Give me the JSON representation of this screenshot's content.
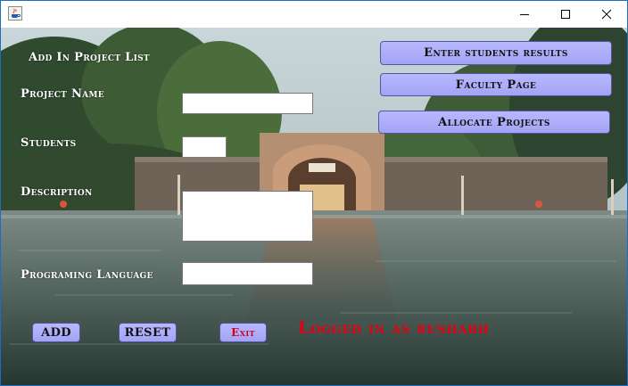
{
  "window": {
    "title": "",
    "controls": {
      "minimize": "minimize",
      "maximize": "maximize",
      "close": "close"
    }
  },
  "form": {
    "heading": "Add In Project List",
    "project_name_label": "Project Name",
    "project_name_value": "",
    "students_label": "Students",
    "students_value": "",
    "description_label": "Description",
    "description_value": "",
    "language_label": "Programing Language",
    "language_value": ""
  },
  "nav": {
    "enter_results": "Enter students results",
    "faculty_page": "Faculty Page",
    "allocate_projects": "Allocate Projects"
  },
  "actions": {
    "add": "ADD",
    "reset": "RESET",
    "exit": "Exit"
  },
  "status": {
    "logged_in": "Logged in as rushabh"
  },
  "colors": {
    "button_fill": "#aaaaf8",
    "status_text": "#e60012",
    "exit_text": "#d2001a",
    "label_text": "#ffffff"
  },
  "icons": {
    "app": "java-coffee-icon",
    "minimize": "minimize-icon",
    "maximize": "maximize-icon",
    "close": "close-icon"
  }
}
